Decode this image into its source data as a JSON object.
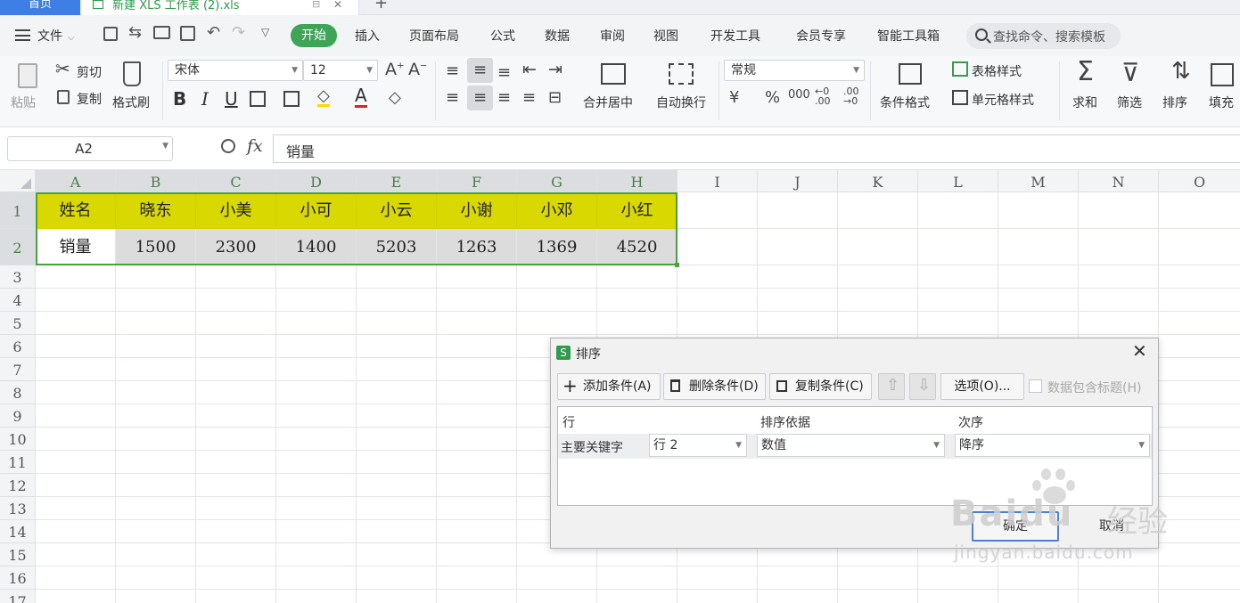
{
  "tabs": {
    "home": "首页",
    "document": "新建 XLS 工作表 (2).xls",
    "add": "+"
  },
  "menu": {
    "file": "文件",
    "items": [
      "开始",
      "插入",
      "页面布局",
      "公式",
      "数据",
      "审阅",
      "视图",
      "开发工具",
      "会员专享",
      "智能工具箱"
    ],
    "search_placeholder": "查找命令、搜索模板"
  },
  "ribbon": {
    "paste": "粘贴",
    "cut": "剪切",
    "copy": "复制",
    "format_painter": "格式刷",
    "font_name": "宋体",
    "font_size": "12",
    "merge_center": "合并居中",
    "wrap_text": "自动换行",
    "number_format": "常规",
    "conditional_format": "条件格式",
    "table_style": "表格样式",
    "cell_style": "单元格样式",
    "sum": "求和",
    "filter": "筛选",
    "sort": "排序",
    "fill": "填充"
  },
  "formula_bar": {
    "name_box": "A2",
    "fx": "fx",
    "content": "销量"
  },
  "sheet": {
    "columns": [
      "A",
      "B",
      "C",
      "D",
      "E",
      "F",
      "G",
      "H",
      "I",
      "J",
      "K",
      "L",
      "M",
      "N",
      "O"
    ],
    "rows": [
      "1",
      "2",
      "3",
      "4",
      "5",
      "6",
      "7",
      "8",
      "9",
      "10",
      "11",
      "12",
      "13",
      "14",
      "15",
      "16",
      "17"
    ],
    "row1": [
      "姓名",
      "晓东",
      "小美",
      "小可",
      "小云",
      "小谢",
      "小邓",
      "小红"
    ],
    "row2": [
      "销量",
      "1500",
      "2300",
      "1400",
      "5203",
      "1263",
      "1369",
      "4520"
    ],
    "highlight_color": "#d9d800",
    "selection_color": "#4aa03f"
  },
  "dialog": {
    "title": "排序",
    "add_condition": "添加条件(A)",
    "delete_condition": "删除条件(D)",
    "copy_condition": "复制条件(C)",
    "options": "选项(O)...",
    "header_checkbox": "数据包含标题(H)",
    "col_row": "行",
    "col_basis": "排序依据",
    "col_order": "次序",
    "primary_key": "主要关键字",
    "key_value": "行 2",
    "basis_value": "数值",
    "order_value": "降序",
    "ok": "确定",
    "cancel": "取消"
  },
  "watermark": {
    "brand": "Baidu",
    "brand_cn": "经验",
    "url": "jingyan.baidu.com"
  }
}
